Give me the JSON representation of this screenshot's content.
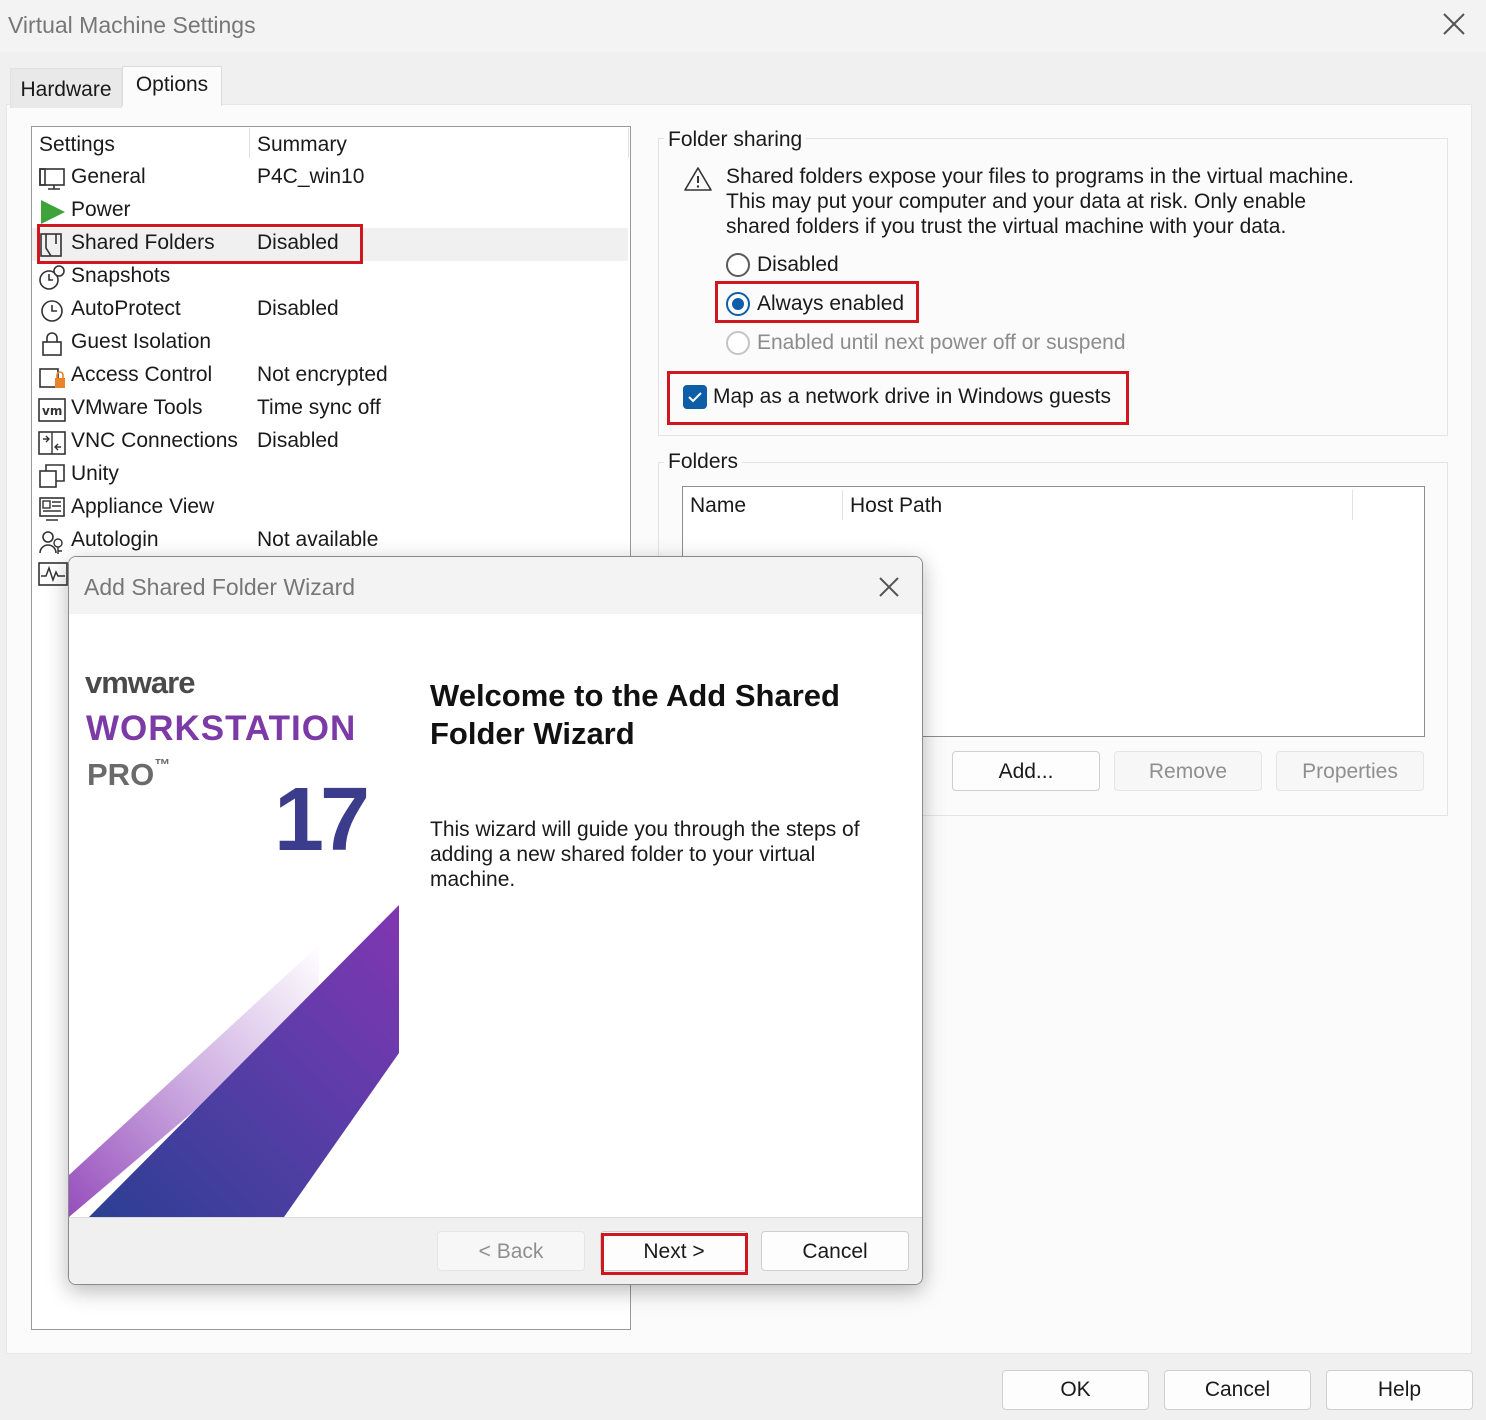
{
  "window": {
    "title": "Virtual Machine Settings"
  },
  "tabs": [
    {
      "label": "Hardware"
    },
    {
      "label": "Options"
    }
  ],
  "settings": {
    "headers": {
      "settings": "Settings",
      "summary": "Summary"
    },
    "rows": [
      {
        "label": "General",
        "summary": "P4C_win10",
        "icon": "monitor-icon"
      },
      {
        "label": "Power",
        "summary": "",
        "icon": "play-icon"
      },
      {
        "label": "Shared Folders",
        "summary": "Disabled",
        "icon": "shared-folder-icon"
      },
      {
        "label": "Snapshots",
        "summary": "",
        "icon": "snapshot-clock-icon"
      },
      {
        "label": "AutoProtect",
        "summary": "Disabled",
        "icon": "clock-icon"
      },
      {
        "label": "Guest Isolation",
        "summary": "",
        "icon": "lock-icon"
      },
      {
        "label": "Access Control",
        "summary": "Not encrypted",
        "icon": "access-control-icon"
      },
      {
        "label": "VMware Tools",
        "summary": "Time sync off",
        "icon": "vm-tools-icon"
      },
      {
        "label": "VNC Connections",
        "summary": "Disabled",
        "icon": "vnc-icon"
      },
      {
        "label": "Unity",
        "summary": "",
        "icon": "unity-icon"
      },
      {
        "label": "Appliance View",
        "summary": "",
        "icon": "appliance-icon"
      },
      {
        "label": "Autologin",
        "summary": "Not available",
        "icon": "users-icon"
      }
    ],
    "selected": "Shared Folders"
  },
  "folder_sharing": {
    "legend": "Folder sharing",
    "warning_lines": [
      "Shared folders expose your files to programs in the virtual machine.",
      "This may put your computer and your data at risk. Only enable",
      "shared folders if you trust the virtual machine with your data."
    ],
    "options": [
      {
        "label": "Disabled",
        "state": "unselected"
      },
      {
        "label": "Always enabled",
        "state": "selected"
      },
      {
        "label": "Enabled until next power off or suspend",
        "state": "disabled"
      }
    ],
    "map_drive": {
      "label": "Map as a network drive in Windows guests",
      "checked": true
    }
  },
  "folders": {
    "legend": "Folders",
    "columns": [
      "Name",
      "Host Path"
    ],
    "buttons": {
      "add": "Add...",
      "remove": "Remove",
      "properties": "Properties"
    }
  },
  "wizard": {
    "title": "Add Shared Folder Wizard",
    "brand": {
      "vmware": "vmware",
      "product": "WORKSTATION",
      "edition": "PRO",
      "tm": "™",
      "version": "17"
    },
    "heading_line1": "Welcome to the Add Shared",
    "heading_line2": "Folder Wizard",
    "description_lines": [
      "This wizard will guide you through the steps of",
      "adding a new shared folder to your virtual",
      "machine."
    ],
    "buttons": {
      "back": "< Back",
      "next": "Next >",
      "cancel": "Cancel"
    }
  },
  "footer": {
    "ok": "OK",
    "cancel": "Cancel",
    "help": "Help"
  },
  "colors": {
    "accent": "#0d5ea6",
    "highlight": "#d0161e",
    "brand_purple": "#7b3aa6",
    "brand_navy": "#3b3c8c"
  }
}
